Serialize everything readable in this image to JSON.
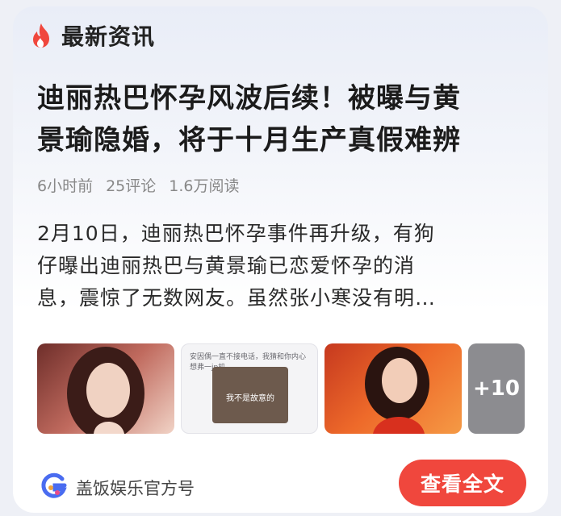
{
  "section": {
    "title": "最新资讯",
    "icon": "flame-icon",
    "accent": "#f0473d"
  },
  "article": {
    "headline_line1": "迪丽热巴怀孕风波后续！被曝与黄",
    "headline_line2": "景瑜隐婚，将于十月生产真假难辨",
    "time": "6小时前",
    "comments": "25评论",
    "reads": "1.6万阅读",
    "summary_line1": "2月10日，迪丽热巴怀孕事件再升级，有狗",
    "summary_line2": "仔曝出迪丽热巴与黄景瑜已恋爱怀孕的消",
    "summary_line3": "息，震惊了无数网友。虽然张小寒没有明…"
  },
  "thumbnails": {
    "chat_top": "安因偶一直不接电话，我猜和你内心想弗一jp机。",
    "meme_caption": "我不是故意的",
    "more_count": "+10"
  },
  "footer": {
    "account": "盖饭娱乐官方号",
    "avatar_icon": "account-logo-icon",
    "read_full_label": "查看全文",
    "button_color": "#f0473d"
  }
}
